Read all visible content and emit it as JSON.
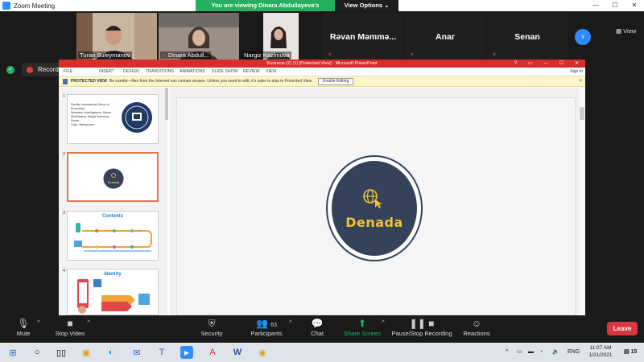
{
  "app": {
    "title": "Zoom Meeting"
  },
  "window_controls": {
    "minimize": "—",
    "maximize": "☐",
    "close": "✕"
  },
  "share_banner": {
    "viewing_text": "You are viewing Dinara Abdullayeva's screen",
    "options_label": "View Options ⌄"
  },
  "gallery": {
    "participants": [
      {
        "name": "Turan Suleymanov",
        "muted": false
      },
      {
        "name": "Dinara Abdull...",
        "muted": true
      },
      {
        "name": "Nargiz Kazimova",
        "muted": false
      },
      {
        "name": "Rəvan Məmmə...",
        "muted": true
      },
      {
        "name": "Anar",
        "muted": true
      },
      {
        "name": "Senan",
        "muted": true
      }
    ],
    "next_icon": "chevron-right-icon",
    "view_label": "View"
  },
  "recording": {
    "label": "Recording..."
  },
  "powerpoint": {
    "title": "Business (2) (1) [Protected View] - Microsoft PowerPoint",
    "ribbon_tabs": [
      "FILE",
      "INSERT",
      "DESIGN",
      "TRANSITIONS",
      "ANIMATIONS",
      "SLIDE SHOW",
      "REVIEW",
      "VIEW"
    ],
    "sign_in": "Sign in",
    "protected_view": {
      "label": "PROTECTED VIEW",
      "message": "Be careful—files from the Internet can contain viruses. Unless you need to edit, it's safer to stay in Protected View.",
      "enable_button": "Enable Editing",
      "close": "×"
    },
    "thumbnails": [
      {
        "num": "1",
        "lines": [
          "Faculty: International School of Economics",
          "Members: Adal Agayeva, Dinara Abdullayeva, Nargiz Kazimova, Senan...",
          "Topic: Startup plan"
        ]
      },
      {
        "num": "2",
        "label": "Denada"
      },
      {
        "num": "3",
        "label": "Contents"
      },
      {
        "num": "4",
        "label": "Identity"
      }
    ],
    "slide": {
      "brand": "Denada"
    }
  },
  "toolbar": {
    "mute": "Mute",
    "stop_video": "Stop Video",
    "security": "Security",
    "participants": "Participants",
    "participants_count": "63",
    "chat": "Chat",
    "share_screen": "Share Screen",
    "pause_recording": "Pause/Stop Recording",
    "reactions": "Reactions",
    "leave": "Leave"
  },
  "taskbar": {
    "language": "ENG",
    "time": "11:07 AM",
    "date": "1/21/2021",
    "notifications": "15"
  },
  "colors": {
    "zoom_blue": "#2d8cff",
    "share_green": "#27ae60",
    "leave_red": "#d9363e",
    "ppt_red": "#d72d2d",
    "slide_navy": "#34425a",
    "slide_gold": "#f2c230"
  }
}
